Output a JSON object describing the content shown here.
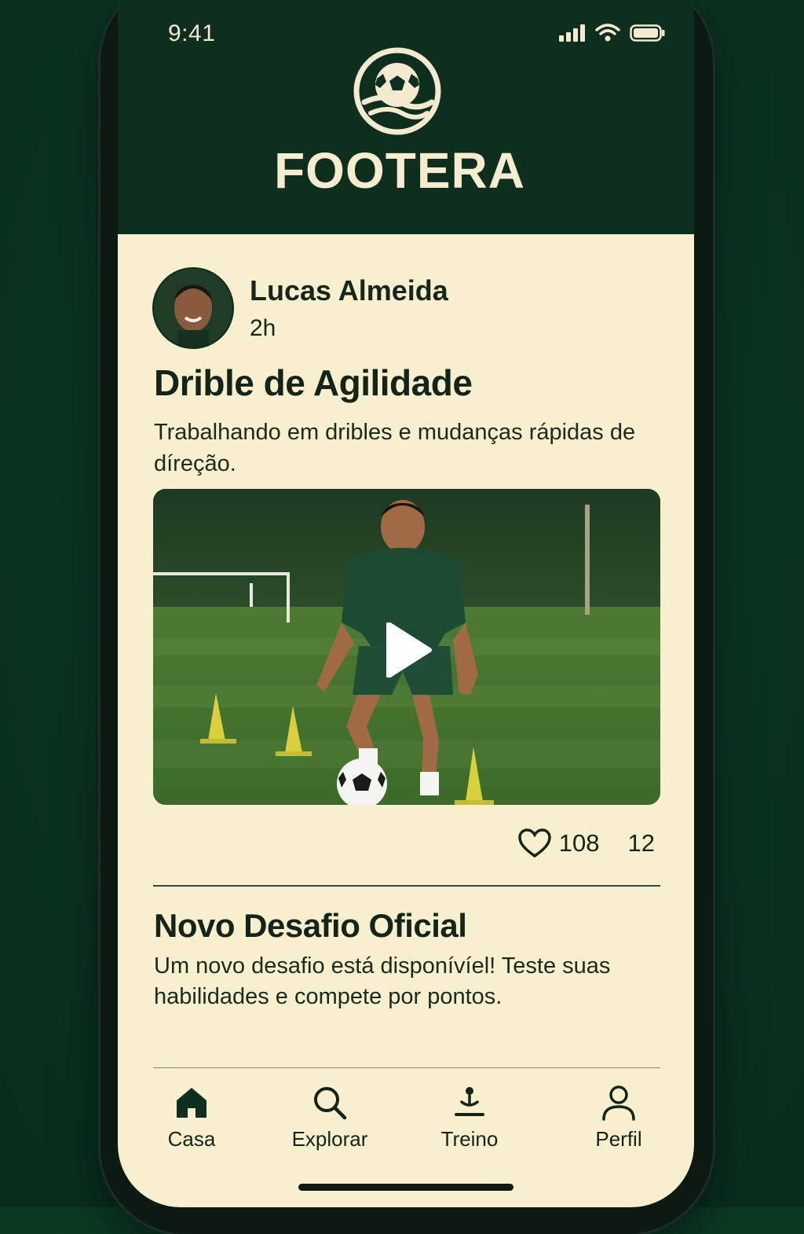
{
  "status_bar": {
    "time": "9:41"
  },
  "header": {
    "brand": "FOOTERA",
    "logo_icon": "soccer-ball-logo-icon"
  },
  "post": {
    "author_name": "Lucas Almeida",
    "time_ago": "2h",
    "title": "Drible de Agilidade",
    "description": "Trabalhando em dribles e mudanças rápidas de díreção.",
    "likes": "108",
    "comments": "12"
  },
  "challenge": {
    "title": "Novo Desafio Oficial",
    "description": "Um novo desafio está disponívíel! Teste suas habilidades e compete por pontos."
  },
  "tabs": [
    {
      "label": "Casa",
      "icon": "home-icon"
    },
    {
      "label": "Explorar",
      "icon": "search-icon"
    },
    {
      "label": "Treino",
      "icon": "training-icon"
    },
    {
      "label": "Perfil",
      "icon": "profile-icon"
    }
  ],
  "colors": {
    "header_bg": "#0e2f1e",
    "content_bg": "#f8efcf",
    "text_dark": "#14241a",
    "accent_cream": "#f6edd1"
  }
}
